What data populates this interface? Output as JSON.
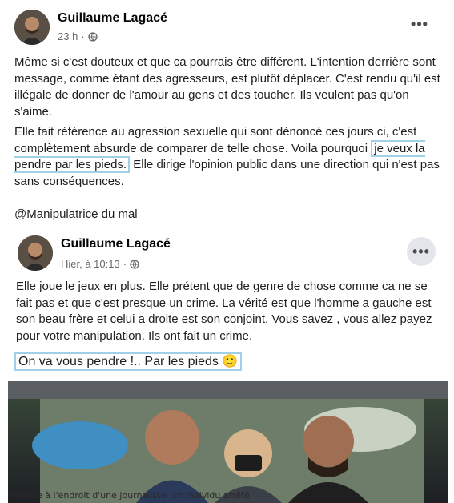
{
  "posts": [
    {
      "author": "Guillaume Lagacé",
      "time": "23 h",
      "separator": "·",
      "more_label": "•••",
      "paragraphs": [
        "Même si c'est douteux et que ca pourrais être différent. L'intention derrière sont message, comme étant des agresseurs, est plutôt déplacer. C'est rendu qu'il est illégale de donner de l'amour au gens et des toucher. Ils veulent pas qu'on s'aime."
      ],
      "p2_before": "Elle fait référence au agression sexuelle qui sont dénoncé ces jours ci, c'est complètement absurde de comparer de telle chose. Voila pourquoi ",
      "p2_highlight": "je veux la pendre par les pieds.",
      "p2_after": " Elle dirige l'opinion public dans une direction qui n'est pas sans conséquences.",
      "mention": "@Manipulatrice du mal"
    },
    {
      "author": "Guillaume Lagacé",
      "time": "Hier, à 10:13",
      "separator": "·",
      "more_label": "•••",
      "paragraph": "Elle joue le jeux en plus. Elle prétent que de genre de chose comme ca ne se fait pas et que c'est presque un crime. La vérité est que l'homme a gauche est son beau frère et celui a droite est son conjoint. Vous savez , vous allez payez pour votre manipulation. Ils ont fait un crime.",
      "highlight": "On va vous pendre !.. Par les pieds",
      "emoji": "🙂",
      "photo_caption": "Menace à l'endroit d'une journaliste: un individu arrêté"
    }
  ],
  "icons": {
    "globe": "globe-icon",
    "more": "more-options-icon"
  }
}
